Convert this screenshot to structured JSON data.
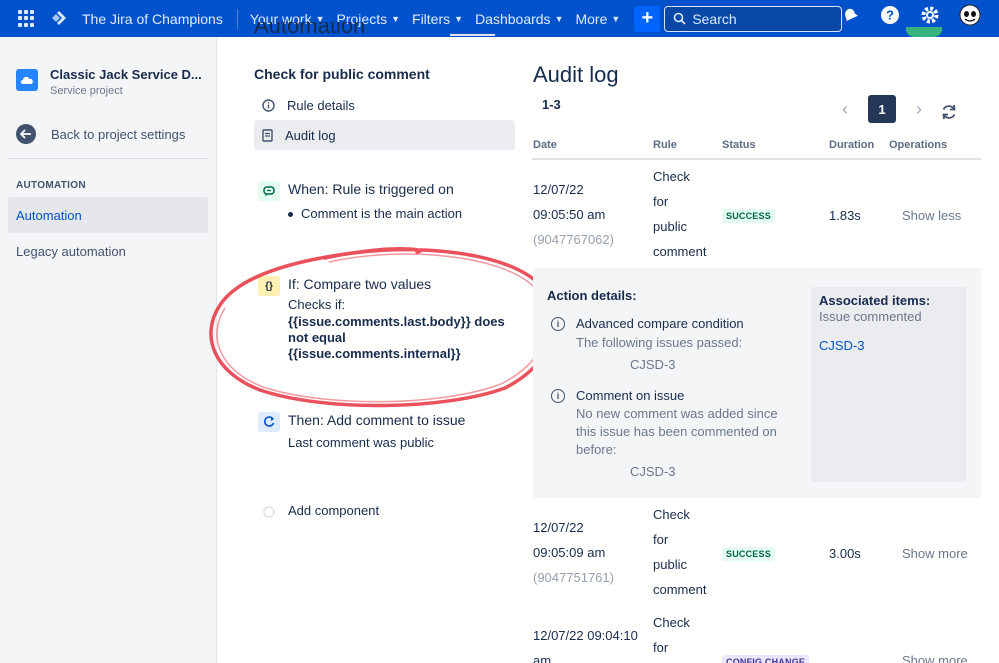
{
  "topnav": {
    "site_name": "The Jira of Champions",
    "items": [
      "Your work",
      "Projects",
      "Filters",
      "Dashboards",
      "More"
    ],
    "create_label": "+",
    "search_placeholder": "Search",
    "accent": "#0052cc"
  },
  "sidebar": {
    "project_name": "Classic Jack Service D...",
    "project_type": "Service project",
    "back_label": "Back to project settings",
    "section_heading": "AUTOMATION",
    "items": [
      {
        "label": "Automation",
        "active": true
      },
      {
        "label": "Legacy automation",
        "active": false
      }
    ]
  },
  "page": {
    "partial_title": "Automation"
  },
  "rule": {
    "title": "Check for public comment",
    "tabs": [
      {
        "label": "Rule details",
        "icon": "info-icon"
      },
      {
        "label": "Audit log",
        "icon": "document-icon"
      }
    ],
    "trigger": {
      "title": "When: Rule is triggered on",
      "detail": "Comment is the main action"
    },
    "condition": {
      "title": "If: Compare two values",
      "subtitle": "Checks if:",
      "expression": "{{issue.comments.last.body}} does not equal {{issue.comments.internal}}"
    },
    "action": {
      "title": "Then: Add comment to issue",
      "detail": "Last comment was public"
    },
    "add_component": "Add component"
  },
  "audit": {
    "title": "Audit log",
    "range": "1-3",
    "current_page": "1",
    "columns": [
      "Date",
      "Rule",
      "Status",
      "Duration",
      "Operations"
    ],
    "rows": [
      {
        "date": "12/07/22",
        "time": "09:05:50 am",
        "exec_id": "(9047767062)",
        "rule": [
          "Check",
          "for",
          "public",
          "comment"
        ],
        "status": "SUCCESS",
        "duration": "1.83s",
        "operation": "Show less"
      },
      {
        "date": "12/07/22",
        "time": "09:05:09 am",
        "exec_id": "(9047751761)",
        "rule": [
          "Check",
          "for",
          "public",
          "comment"
        ],
        "status": "SUCCESS",
        "duration": "3.00s",
        "operation": "Show more"
      },
      {
        "date": "12/07/22 09:04:10",
        "time": "am",
        "exec_id": "",
        "rule": [
          "Check",
          "for"
        ],
        "status": "CONFIG CHANGE",
        "duration": "",
        "operation": "Show more"
      }
    ],
    "details": {
      "heading": "Action details:",
      "actions": [
        {
          "title": "Advanced compare condition",
          "text": "The following issues passed:",
          "key": "CJSD-3"
        },
        {
          "title": "Comment on issue",
          "text": "No new comment was added since this issue has been commented on before:",
          "key": "CJSD-3"
        }
      ],
      "associated_heading": "Associated items:",
      "associated_sub": "Issue commented",
      "associated_key": "CJSD-3"
    }
  }
}
